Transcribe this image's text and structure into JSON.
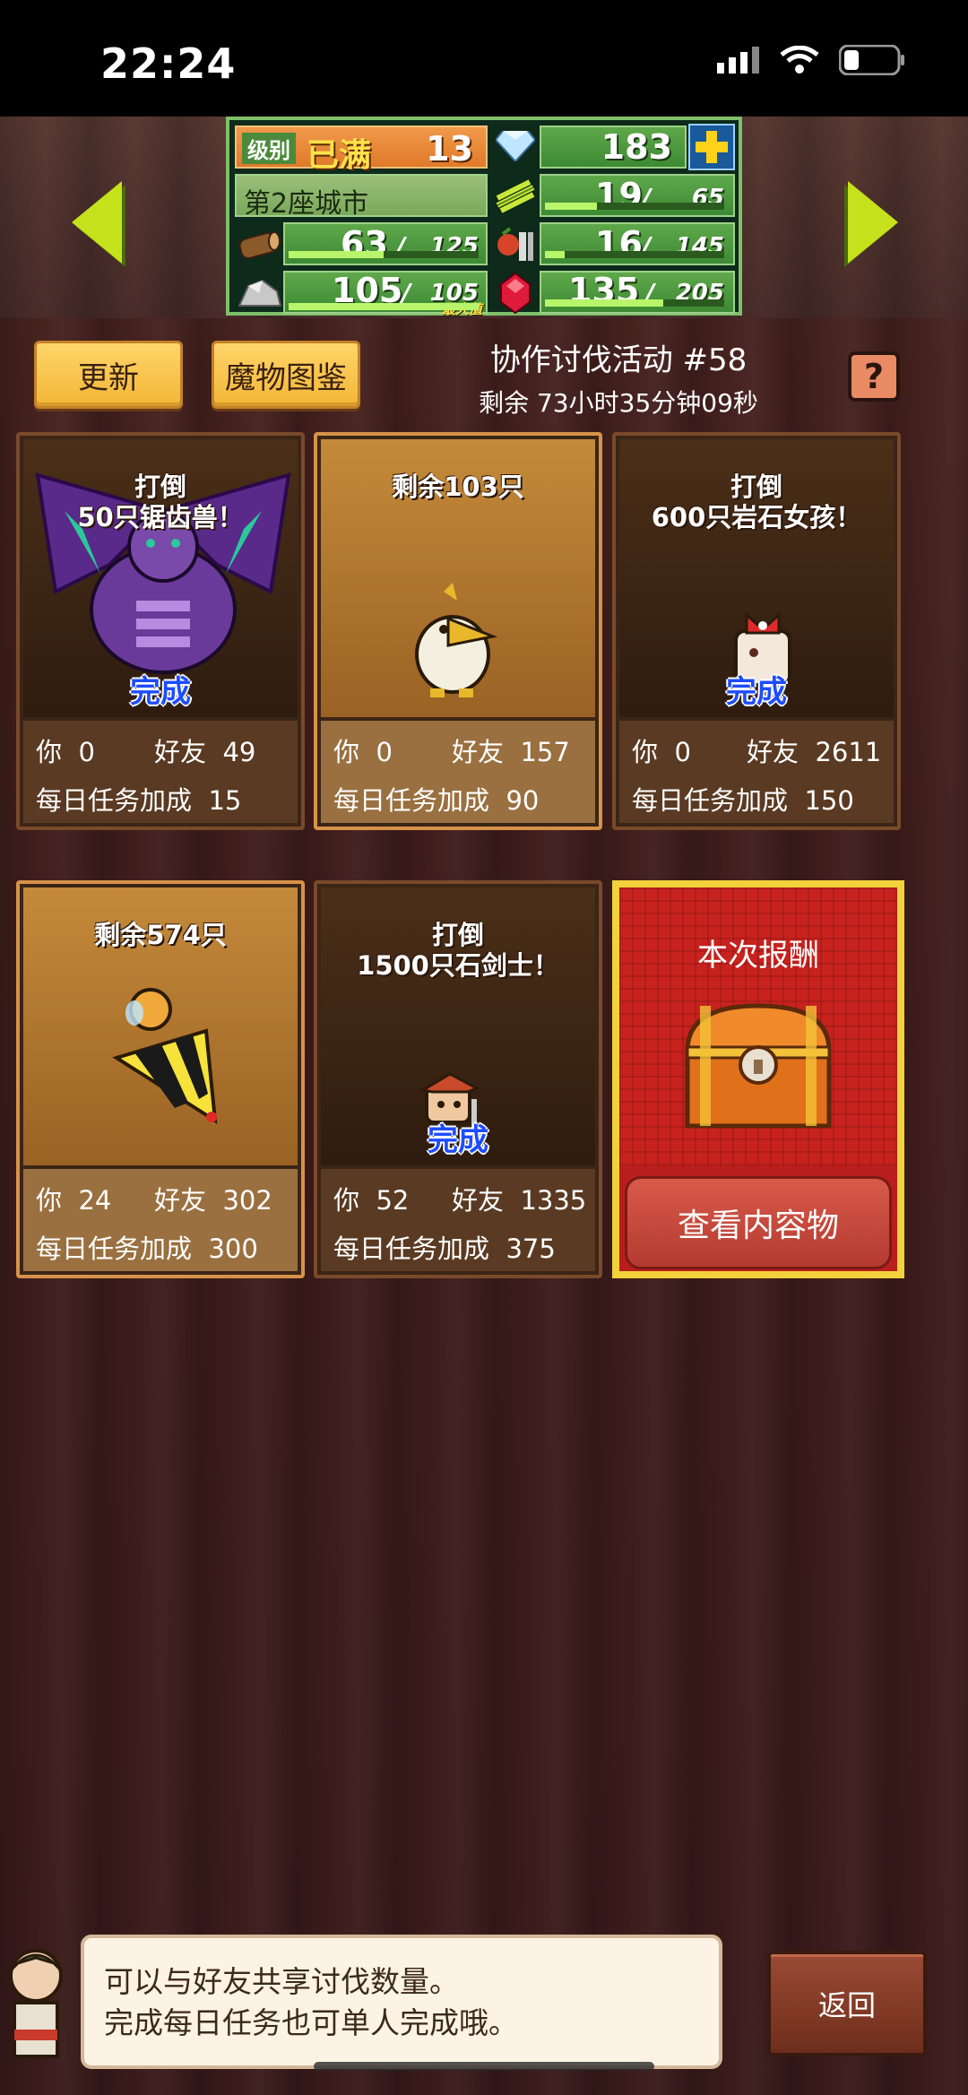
{
  "status_bar": {
    "time": "22:24"
  },
  "header": {
    "level_label": "级别",
    "level_status": "已满",
    "level_value": "13",
    "gems": "183",
    "city_name": "第2座城市",
    "res": {
      "wood": {
        "cur": "63",
        "max": "125",
        "fill": 0.5
      },
      "crop": {
        "cur": "19",
        "max": "65",
        "fill": 0.29
      },
      "food": {
        "cur": "16",
        "max": "145",
        "fill": 0.11
      },
      "stone": {
        "cur": "105",
        "max": "105",
        "fill": 1.0,
        "tag": "最大值"
      },
      "ruby": {
        "cur": "135",
        "max": "205",
        "fill": 0.66
      }
    }
  },
  "toolbar": {
    "refresh_label": "更新",
    "bestiary_label": "魔物图鉴",
    "event_title": "协作讨伐活动 #58",
    "event_remaining": "剩余 73小时35分钟09秒",
    "help_label": "?"
  },
  "cards": [
    {
      "title_line1": "打倒",
      "title_line2": "50只锯齿兽！",
      "done": "完成",
      "you_label": "你",
      "you": "0",
      "friend_label": "好友",
      "friend": "49",
      "daily_label": "每日任务加成",
      "daily": "15"
    },
    {
      "title_line1": "剩余103只",
      "title_line2": "",
      "done": "",
      "you_label": "你",
      "you": "0",
      "friend_label": "好友",
      "friend": "157",
      "daily_label": "每日任务加成",
      "daily": "90"
    },
    {
      "title_line1": "打倒",
      "title_line2": "600只岩石女孩！",
      "done": "完成",
      "you_label": "你",
      "you": "0",
      "friend_label": "好友",
      "friend": "2611",
      "daily_label": "每日任务加成",
      "daily": "150"
    },
    {
      "title_line1": "剩余574只",
      "title_line2": "",
      "done": "",
      "you_label": "你",
      "you": "24",
      "friend_label": "好友",
      "friend": "302",
      "daily_label": "每日任务加成",
      "daily": "300"
    },
    {
      "title_line1": "打倒",
      "title_line2": "1500只石剑士！",
      "done": "完成",
      "you_label": "你",
      "you": "52",
      "friend_label": "好友",
      "friend": "1335",
      "daily_label": "每日任务加成",
      "daily": "375"
    }
  ],
  "reward": {
    "title": "本次报酬",
    "button": "查看内容物"
  },
  "tip": {
    "line1": "可以与好友共享讨伐数量。",
    "line2": "完成每日任务也可单人完成哦。"
  },
  "back_label": "返回",
  "icons": {
    "gem": "diamond-icon",
    "plus": "plus-icon",
    "wood": "wood-log-icon",
    "crop": "crop-icon",
    "food": "food-icon",
    "stone": "stone-icon",
    "ruby": "ruby-icon",
    "chest": "treasure-chest-icon"
  }
}
